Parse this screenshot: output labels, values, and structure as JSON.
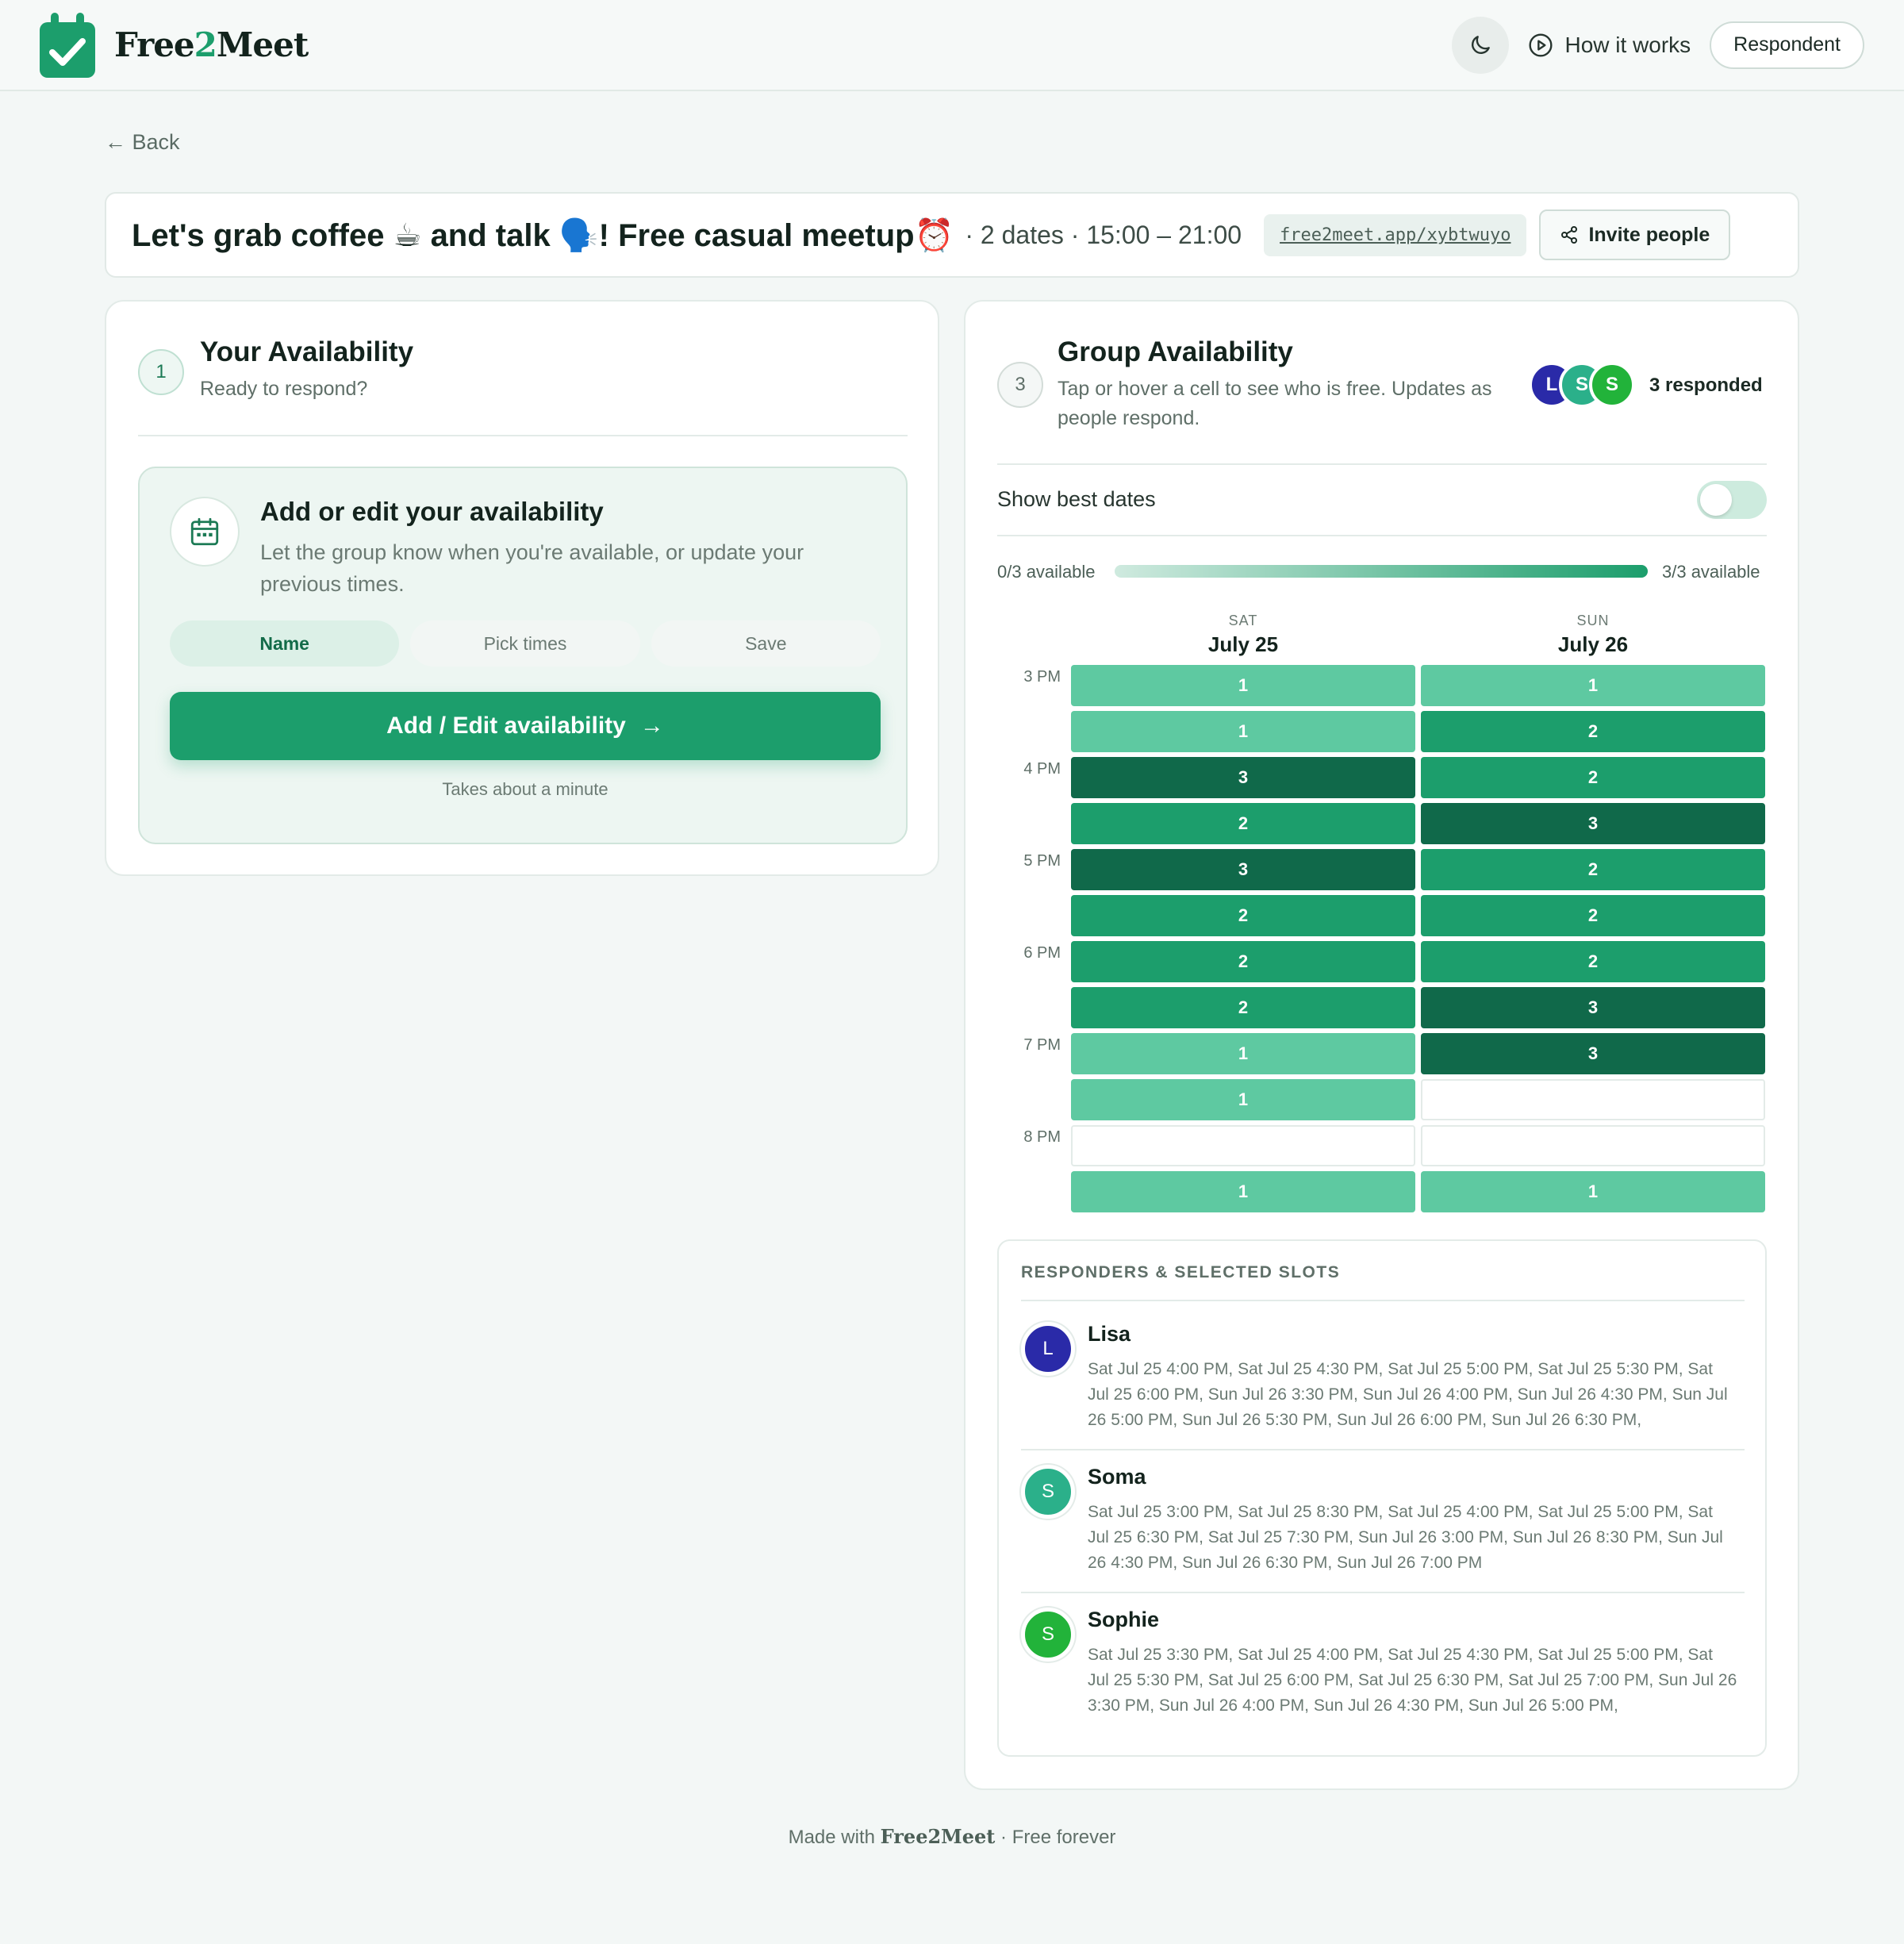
{
  "header": {
    "brand_a": "Free",
    "brand_b": "2",
    "brand_c": "Meet",
    "how_label": "How it works",
    "respondent_label": "Respondent"
  },
  "back_label": "← Back",
  "event": {
    "title": "Let's grab coffee ☕ and talk 🗣️! Free casual meetup⏰",
    "meta": "· 2 dates · 15:00 – 21:00",
    "link": "free2meet.app/xybtwuyo",
    "invite_label": "Invite people"
  },
  "your": {
    "step": "1",
    "title": "Your Availability",
    "subtitle": "Ready to respond?",
    "box_title": "Add or edit your availability",
    "box_sub": "Let the group know when you're available, or update your previous times.",
    "steps": [
      "Name",
      "Pick times",
      "Save"
    ],
    "cta": "Add / Edit availability",
    "cta_arrow": "→",
    "note": "Takes about a minute"
  },
  "group": {
    "step": "3",
    "title": "Group Availability",
    "subtitle": "Tap or hover a cell to see who is free. Updates as people respond.",
    "avatars": [
      {
        "initial": "L",
        "color": "#2a2aa8"
      },
      {
        "initial": "S",
        "color": "#2bb08a"
      },
      {
        "initial": "S",
        "color": "#22b33a"
      }
    ],
    "responded": "3 responded",
    "best_dates_label": "Show best dates",
    "best_dates_on": false,
    "legend_min": "0/3 available",
    "legend_max": "3/3 available",
    "days": [
      {
        "dow": "SAT",
        "date": "July 25"
      },
      {
        "dow": "SUN",
        "date": "July 26"
      }
    ],
    "time_labels": [
      "3 PM",
      "",
      "4 PM",
      "",
      "5 PM",
      "",
      "6 PM",
      "",
      "7 PM",
      "",
      "8 PM",
      ""
    ],
    "counts": [
      [
        1,
        1
      ],
      [
        1,
        2
      ],
      [
        3,
        2
      ],
      [
        2,
        3
      ],
      [
        3,
        2
      ],
      [
        2,
        2
      ],
      [
        2,
        2
      ],
      [
        2,
        3
      ],
      [
        1,
        3
      ],
      [
        1,
        0
      ],
      [
        0,
        0
      ],
      [
        1,
        1
      ]
    ],
    "colors": {
      "c0": "#ffffff",
      "c1": "#5ec9a1",
      "c2": "#1c9e6c",
      "c3": "#10694a"
    }
  },
  "responders": {
    "title": "RESPONDERS & SELECTED SLOTS",
    "items": [
      {
        "name": "Lisa",
        "initial": "L",
        "color": "#2a2aa8",
        "slots": "Sat Jul 25 4:00 PM, Sat Jul 25 4:30 PM, Sat Jul 25 5:00 PM, Sat Jul 25 5:30 PM, Sat Jul 25 6:00 PM, Sun Jul 26 3:30 PM, Sun Jul 26 4:00 PM, Sun Jul 26 4:30 PM, Sun Jul 26 5:00 PM, Sun Jul 26 5:30 PM, Sun Jul 26 6:00 PM, Sun Jul 26 6:30 PM,"
      },
      {
        "name": "Soma",
        "initial": "S",
        "color": "#2bb08a",
        "slots": "Sat Jul 25 3:00 PM, Sat Jul 25 8:30 PM, Sat Jul 25 4:00 PM, Sat Jul 25 5:00 PM, Sat Jul 25 6:30 PM, Sat Jul 25 7:30 PM, Sun Jul 26 3:00 PM, Sun Jul 26 8:30 PM, Sun Jul 26 4:30 PM, Sun Jul 26 6:30 PM, Sun Jul 26 7:00 PM"
      },
      {
        "name": "Sophie",
        "initial": "S",
        "color": "#22b33a",
        "slots": "Sat Jul 25 3:30 PM, Sat Jul 25 4:00 PM, Sat Jul 25 4:30 PM, Sat Jul 25 5:00 PM, Sat Jul 25 5:30 PM, Sat Jul 25 6:00 PM, Sat Jul 25 6:30 PM, Sat Jul 25 7:00 PM, Sun Jul 26 3:30 PM, Sun Jul 26 4:00 PM, Sun Jul 26 4:30 PM, Sun Jul 26 5:00 PM,"
      }
    ]
  },
  "footer": {
    "prefix": "Made with",
    "brand": "Free2Meet",
    "suffix": "· Free forever"
  }
}
